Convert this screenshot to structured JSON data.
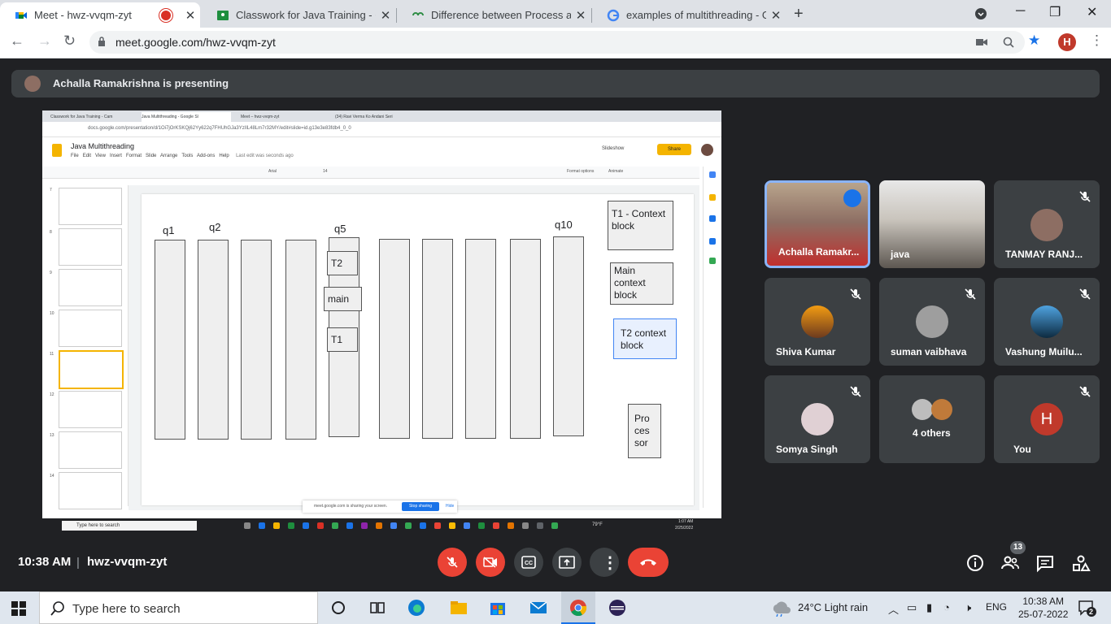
{
  "browser": {
    "tabs": [
      {
        "label": "Meet - hwz-vvqm-zyt",
        "icon": "google-meet-icon",
        "recording": true
      },
      {
        "label": "Classwork for Java Training - Cam",
        "icon": "google-classroom-icon"
      },
      {
        "label": "Difference between Process and",
        "icon": "geeksforgeeks-icon"
      },
      {
        "label": "examples of multithreading - Go",
        "icon": "google-icon"
      }
    ],
    "url": "meet.google.com/hwz-vvqm-zyt",
    "profile_initial": "H"
  },
  "presenter_banner": "Achalla Ramakrishna is presenting",
  "shared_screen": {
    "tabs": [
      "Classwork for Java Training - Cam",
      "Java Multithreading - Google Sl",
      "Meet – hwz-vvqm-zyt",
      "(34) Ravi Verma Ko Andani Seri"
    ],
    "url": "docs.google.com/presentation/d/1Oi7jOrKSKQj62Yy622q7FHUhGJa3YzIlL48Lm7r32MY/edit#slide=id.g13e3e83fdb4_0_0",
    "doc_title": "Java Multithreading",
    "menu": [
      "File",
      "Edit",
      "View",
      "Insert",
      "Format",
      "Slide",
      "Arrange",
      "Tools",
      "Add-ons",
      "Help"
    ],
    "last_edit": "Last edit was seconds ago",
    "slideshow_label": "Slideshow",
    "share_label": "Share",
    "font_name": "Arial",
    "font_size": "14",
    "format_options": "Format options",
    "animate": "Animate",
    "thumb_numbers": [
      "7",
      "8",
      "9",
      "10",
      "11",
      "12",
      "13",
      "14"
    ],
    "slide": {
      "queue_labels": [
        "q1",
        "q2",
        "q5",
        "q10"
      ],
      "stack_items": [
        "T2",
        "main",
        "T1"
      ],
      "right_boxes": [
        "T1 - Context block",
        "Main context block",
        "T2 context block"
      ],
      "processor": "Pro ces sor"
    },
    "share_notice": "meet.google.com is sharing your screen.",
    "stop_sharing": "Stop sharing",
    "hide": "Hide",
    "taskbar_search": "Type here to search",
    "weather": "79°F",
    "time": "1:07 AM",
    "date": "2/25/2022"
  },
  "participants": [
    {
      "name": "Achalla Ramakr...",
      "speaking": true,
      "video": true
    },
    {
      "name": "java",
      "video": true
    },
    {
      "name": "TANMAY RANJ...",
      "muted": true
    },
    {
      "name": "Shiva Kumar",
      "muted": true
    },
    {
      "name": "suman vaibhava",
      "muted": true
    },
    {
      "name": "Vashung Muilu...",
      "muted": true
    },
    {
      "name": "Somya Singh",
      "muted": true
    },
    {
      "name": "4 others"
    },
    {
      "name": "You",
      "initial": "H",
      "muted": true
    }
  ],
  "meet_bar": {
    "time": "10:38 AM",
    "meeting_code": "hwz-vvqm-zyt",
    "people_count": "13"
  },
  "taskbar": {
    "search_placeholder": "Type here to search",
    "weather": "24°C  Light rain",
    "language": "ENG",
    "time": "10:38 AM",
    "date": "25-07-2022",
    "notification_count": "2"
  },
  "colors": {
    "meet_bg": "#202124",
    "tile_bg": "#3c4043",
    "red": "#ea4335",
    "accent_blue": "#1a73e8",
    "slides_yellow": "#f4b400"
  }
}
